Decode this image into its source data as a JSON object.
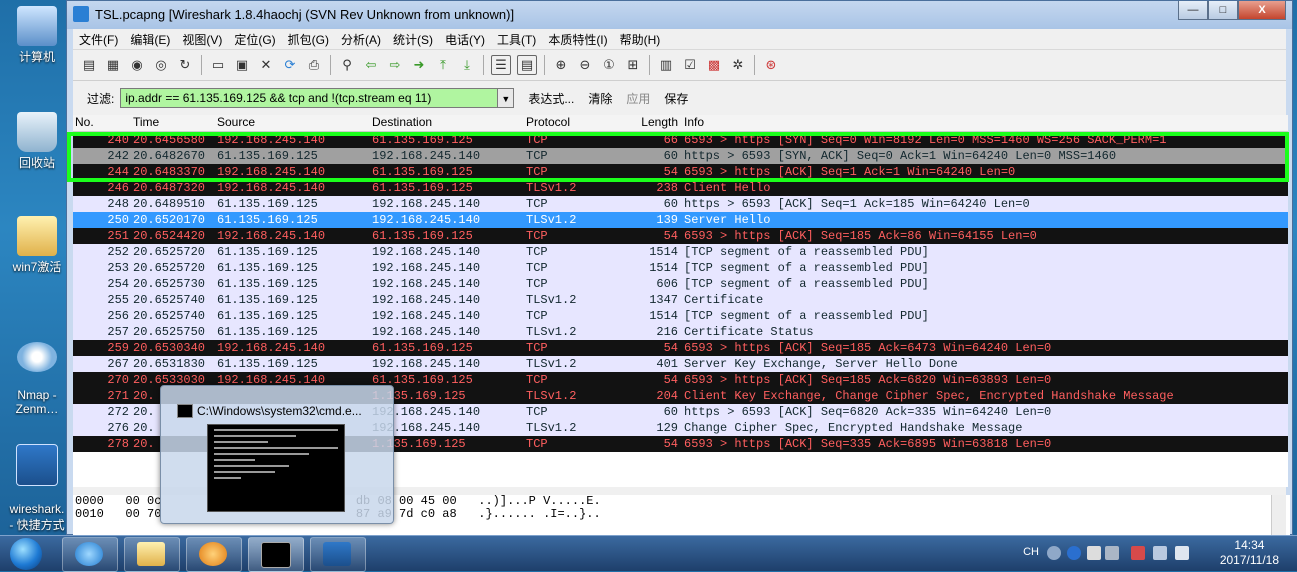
{
  "desktop": {
    "icons": [
      {
        "label": "计算机"
      },
      {
        "label": "回收站"
      },
      {
        "label": "win7激活"
      },
      {
        "label": "Nmap -\nZenm…"
      },
      {
        "label": "wireshark.\n- 快捷方式"
      }
    ]
  },
  "window": {
    "title": "TSL.pcapng   [Wireshark 1.8.4haochj  (SVN Rev Unknown from unknown)]",
    "buttons": {
      "minimize": "—",
      "maximize": "□",
      "close": "X"
    }
  },
  "menu": [
    "文件(F)",
    "编辑(E)",
    "视图(V)",
    "定位(G)",
    "抓包(G)",
    "分析(A)",
    "统计(S)",
    "电话(Y)",
    "工具(T)",
    "本质特性(I)",
    "帮助(H)"
  ],
  "filter": {
    "label": "过滤:",
    "value": "ip.addr == 61.135.169.125 && tcp and !(tcp.stream eq 11)",
    "expr_button": "表达式...",
    "clear_button": "清除",
    "apply_button": "应用",
    "save_button": "保存"
  },
  "packet_list": {
    "headers": {
      "no": "No.",
      "time": "Time",
      "source": "Source",
      "destination": "Destination",
      "protocol": "Protocol",
      "length": "Length",
      "info": "Info"
    },
    "rows": [
      {
        "no": "240",
        "time": "20.6456580",
        "src": "192.168.245.140",
        "dst": "61.135.169.125",
        "proto": "TCP",
        "len": "66",
        "info": "6593 > https [SYN] Seq=0 Win=8192 Len=0 MSS=1460 WS=256 SACK_PERM=1",
        "style": "black"
      },
      {
        "no": "242",
        "time": "20.6482670",
        "src": "61.135.169.125",
        "dst": "192.168.245.140",
        "proto": "TCP",
        "len": "60",
        "info": "https > 6593 [SYN, ACK] Seq=0 Ack=1 Win=64240 Len=0 MSS=1460",
        "style": "gray"
      },
      {
        "no": "244",
        "time": "20.6483370",
        "src": "192.168.245.140",
        "dst": "61.135.169.125",
        "proto": "TCP",
        "len": "54",
        "info": "6593 > https [ACK] Seq=1 Ack=1 Win=64240 Len=0",
        "style": "black"
      },
      {
        "no": "246",
        "time": "20.6487320",
        "src": "192.168.245.140",
        "dst": "61.135.169.125",
        "proto": "TLSv1.2",
        "len": "238",
        "info": "Client Hello",
        "style": "black"
      },
      {
        "no": "248",
        "time": "20.6489510",
        "src": "61.135.169.125",
        "dst": "192.168.245.140",
        "proto": "TCP",
        "len": "60",
        "info": "https > 6593 [ACK] Seq=1 Ack=185 Win=64240 Len=0",
        "style": "light"
      },
      {
        "no": "250",
        "time": "20.6520170",
        "src": "61.135.169.125",
        "dst": "192.168.245.140",
        "proto": "TLSv1.2",
        "len": "139",
        "info": "Server Hello",
        "style": "sel"
      },
      {
        "no": "251",
        "time": "20.6524420",
        "src": "192.168.245.140",
        "dst": "61.135.169.125",
        "proto": "TCP",
        "len": "54",
        "info": "6593 > https [ACK] Seq=185 Ack=86 Win=64155 Len=0",
        "style": "black"
      },
      {
        "no": "252",
        "time": "20.6525720",
        "src": "61.135.169.125",
        "dst": "192.168.245.140",
        "proto": "TCP",
        "len": "1514",
        "info": "[TCP segment of a reassembled PDU]",
        "style": "light"
      },
      {
        "no": "253",
        "time": "20.6525720",
        "src": "61.135.169.125",
        "dst": "192.168.245.140",
        "proto": "TCP",
        "len": "1514",
        "info": "[TCP segment of a reassembled PDU]",
        "style": "light"
      },
      {
        "no": "254",
        "time": "20.6525730",
        "src": "61.135.169.125",
        "dst": "192.168.245.140",
        "proto": "TCP",
        "len": "606",
        "info": "[TCP segment of a reassembled PDU]",
        "style": "light"
      },
      {
        "no": "255",
        "time": "20.6525740",
        "src": "61.135.169.125",
        "dst": "192.168.245.140",
        "proto": "TLSv1.2",
        "len": "1347",
        "info": "Certificate",
        "style": "light"
      },
      {
        "no": "256",
        "time": "20.6525740",
        "src": "61.135.169.125",
        "dst": "192.168.245.140",
        "proto": "TCP",
        "len": "1514",
        "info": "[TCP segment of a reassembled PDU]",
        "style": "light"
      },
      {
        "no": "257",
        "time": "20.6525750",
        "src": "61.135.169.125",
        "dst": "192.168.245.140",
        "proto": "TLSv1.2",
        "len": "216",
        "info": "Certificate Status",
        "style": "light"
      },
      {
        "no": "259",
        "time": "20.6530340",
        "src": "192.168.245.140",
        "dst": "61.135.169.125",
        "proto": "TCP",
        "len": "54",
        "info": "6593 > https [ACK] Seq=185 Ack=6473 Win=64240 Len=0",
        "style": "black"
      },
      {
        "no": "267",
        "time": "20.6531830",
        "src": "61.135.169.125",
        "dst": "192.168.245.140",
        "proto": "TLSv1.2",
        "len": "401",
        "info": "Server Key Exchange, Server Hello Done",
        "style": "light"
      },
      {
        "no": "270",
        "time": "20.6533030",
        "src": "192.168.245.140",
        "dst": "61.135.169.125",
        "proto": "TCP",
        "len": "54",
        "info": "6593 > https [ACK] Seq=185 Ack=6820 Win=63893 Len=0",
        "style": "black"
      },
      {
        "no": "271",
        "time": "20.",
        "src": "",
        "dst": "1.135.169.125",
        "proto": "TLSv1.2",
        "len": "204",
        "info": "Client Key Exchange, Change Cipher Spec, Encrypted Handshake Message",
        "style": "black"
      },
      {
        "no": "272",
        "time": "20.",
        "src": "",
        "dst": "192.168.245.140",
        "proto": "TCP",
        "len": "60",
        "info": "https > 6593 [ACK] Seq=6820 Ack=335 Win=64240 Len=0",
        "style": "light"
      },
      {
        "no": "276",
        "time": "20.",
        "src": "",
        "dst": "192.168.245.140",
        "proto": "TLSv1.2",
        "len": "129",
        "info": "Change Cipher Spec, Encrypted Handshake Message",
        "style": "light"
      },
      {
        "no": "278",
        "time": "20.",
        "src": "",
        "dst": "1.135.169.125",
        "proto": "TCP",
        "len": "54",
        "info": "6593 > https [ACK] Seq=335 Ack=6895 Win=63818 Len=0",
        "style": "black"
      }
    ]
  },
  "hex_pane": {
    "lines": [
      "0000   00 0c                           db 08 00 45 00   ..)]...P V.....E.",
      "0010   00 70                           87 a9 7d c0 a8   .}...... .I=..}.."
    ]
  },
  "thumbnail": {
    "title": "C:\\Windows\\system32\\cmd.e..."
  },
  "tray": {
    "lang": "CH",
    "time": "14:34",
    "date": "2017/11/18"
  },
  "colors": {
    "filter_ok": "#b0f5a0",
    "row_black_bg": "#121212",
    "row_black_fg": "#ff5f5f",
    "row_light_bg": "#e7e6ff",
    "row_selected": "#3399ff",
    "highlight_box": "#1bff1b"
  }
}
